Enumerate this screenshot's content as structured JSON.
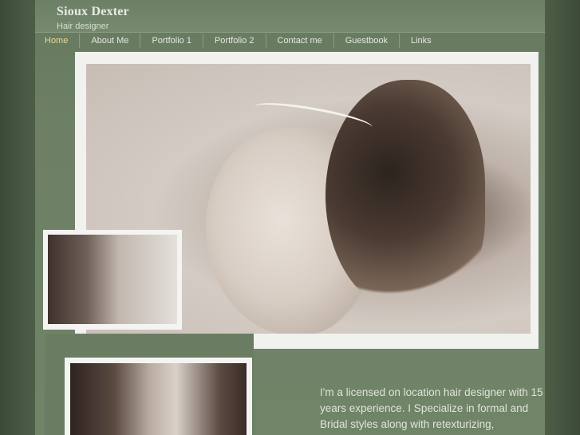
{
  "site": {
    "title": "Sioux Dexter",
    "subtitle": "Hair designer"
  },
  "nav": [
    {
      "label": "Home",
      "active": true
    },
    {
      "label": "About Me"
    },
    {
      "label": "Portfolio 1"
    },
    {
      "label": "Portfolio 2"
    },
    {
      "label": "Contact me"
    },
    {
      "label": "Guestbook"
    },
    {
      "label": "Links"
    }
  ],
  "photos": {
    "main": "bridal-updo-profile-photo",
    "small": "bride-veil-photo",
    "bottom": "couple-photo"
  },
  "intro": {
    "text": "I'm a licensed on location hair designer with 15 years experience. I Specialize in formal and Bridal styles along with retexturizing,"
  },
  "colors": {
    "active_nav": "#ecd98f",
    "text": "#dfe6d9",
    "background": "#56684f"
  }
}
